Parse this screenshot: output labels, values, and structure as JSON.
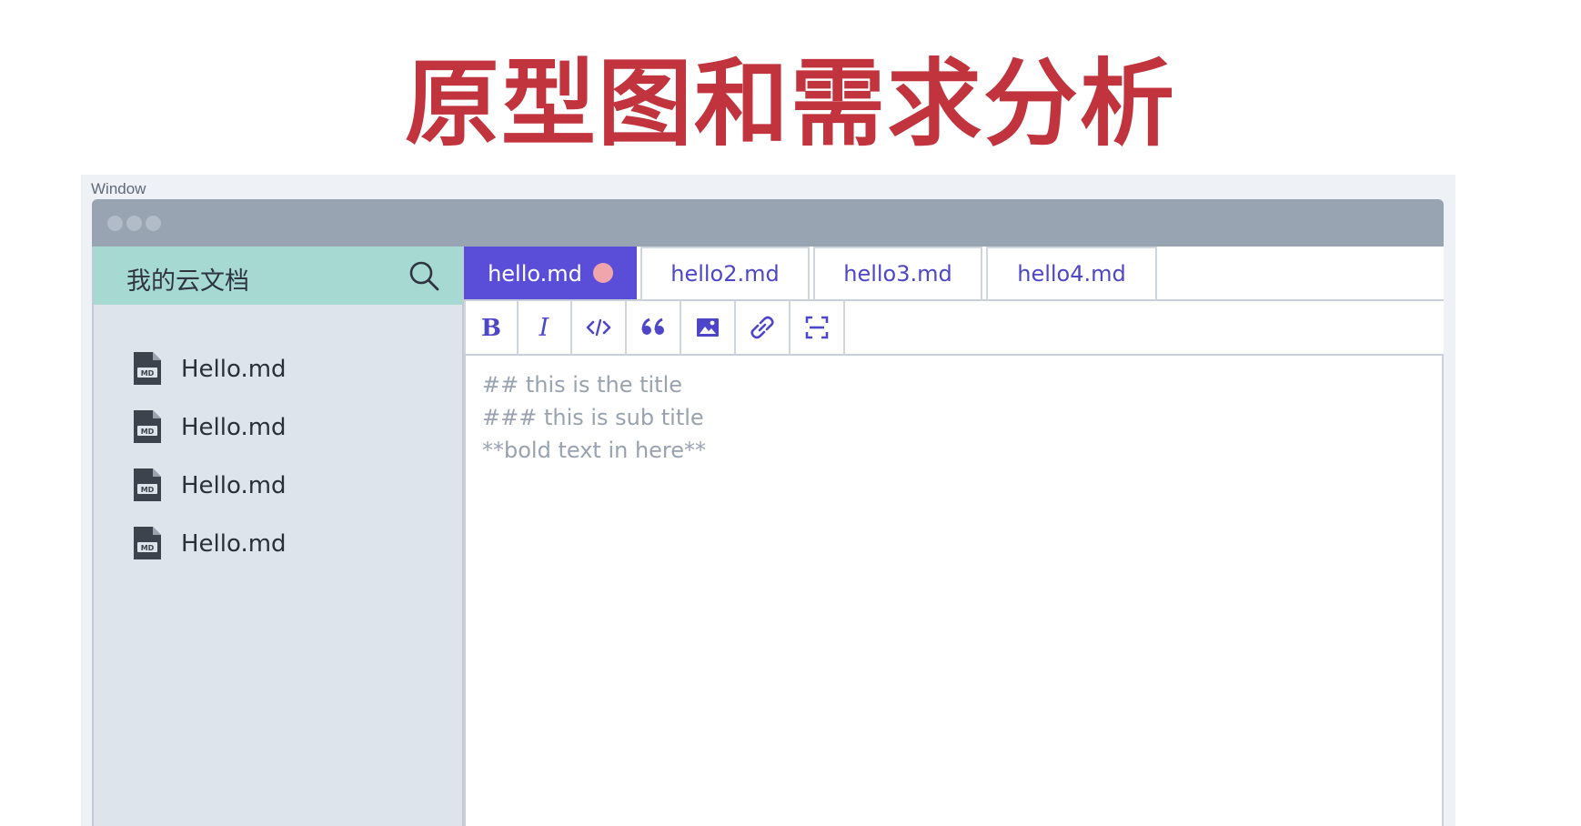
{
  "slide": {
    "title": "原型图和需求分析"
  },
  "window": {
    "label": "Window"
  },
  "sidebar": {
    "title": "我的云文档",
    "files": [
      {
        "name": "Hello.md",
        "icon": "markdown-file-icon"
      },
      {
        "name": "Hello.md",
        "icon": "markdown-file-icon"
      },
      {
        "name": "Hello.md",
        "icon": "markdown-file-icon"
      },
      {
        "name": "Hello.md",
        "icon": "markdown-file-icon"
      }
    ]
  },
  "tabs": [
    {
      "label": "hello.md",
      "active": true,
      "unsaved": true
    },
    {
      "label": "hello2.md",
      "active": false
    },
    {
      "label": "hello3.md",
      "active": false
    },
    {
      "label": "hello4.md",
      "active": false
    }
  ],
  "toolbar": {
    "buttons": [
      "bold-icon",
      "italic-icon",
      "code-icon",
      "quote-icon",
      "image-icon",
      "link-icon",
      "fullscreen-icon"
    ]
  },
  "editor": {
    "lines": [
      "## this is the title",
      "### this is sub title",
      "**bold text in here**"
    ]
  },
  "colors": {
    "title": "#c2343d",
    "accent": "#5a4ed9",
    "sidebar_header": "#a7d9d3",
    "sidebar_bg": "#dee4ec",
    "titlebar": "#98a4b1",
    "unsaved_dot": "#f0a5ac"
  }
}
